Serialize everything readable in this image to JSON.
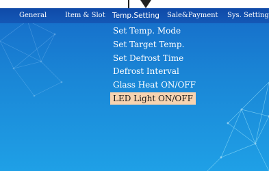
{
  "tabs": [
    {
      "label": "General"
    },
    {
      "label": "Item & Slot"
    },
    {
      "label": "Temp.Setting"
    },
    {
      "label": "Sale&Payment"
    },
    {
      "label": "Sys. Setting"
    }
  ],
  "active_tab": "Temp.Setting",
  "menu": {
    "items": [
      {
        "label": "Set Temp. Mode"
      },
      {
        "label": "Set Target Temp."
      },
      {
        "label": "Set Defrost Time"
      },
      {
        "label": "Defrost Interval"
      },
      {
        "label": "Glass Heat ON/OFF"
      },
      {
        "label": "LED Light ON/OFF"
      }
    ],
    "selected_index": 5
  },
  "colors": {
    "background": "#1a86d6",
    "tab_bar": "#1458b6",
    "selected_highlight": "#f7d3b0",
    "text": "#ffffff"
  }
}
